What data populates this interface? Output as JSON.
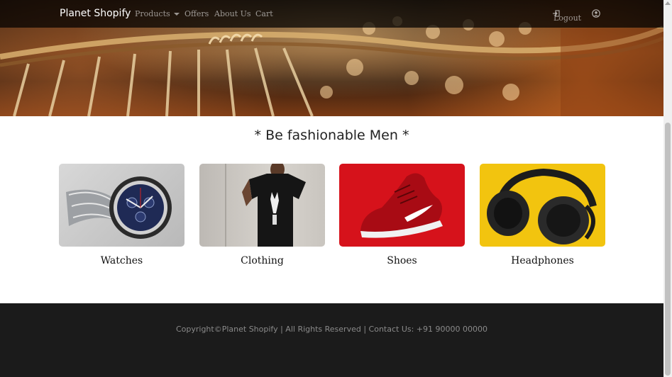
{
  "navbar": {
    "brand": "Planet Shopify",
    "links": {
      "products": "Products",
      "offers": "Offers",
      "about": "About Us",
      "cart": "Cart"
    },
    "logout": "Logout"
  },
  "main": {
    "heading": "* Be fashionable Men *",
    "categories": [
      {
        "label": "Watches",
        "icon": "watch-image"
      },
      {
        "label": "Clothing",
        "icon": "tshirt-image"
      },
      {
        "label": "Shoes",
        "icon": "sneaker-image"
      },
      {
        "label": "Headphones",
        "icon": "headphones-image"
      }
    ]
  },
  "footer": {
    "text": "Copyright©Planet Shopify | All Rights Reserved | Contact Us: +91 90000 00000"
  },
  "colors": {
    "footer_bg": "#1b1b1b",
    "shoes_bg": "#d6121b",
    "headphones_bg": "#f2c40f"
  }
}
